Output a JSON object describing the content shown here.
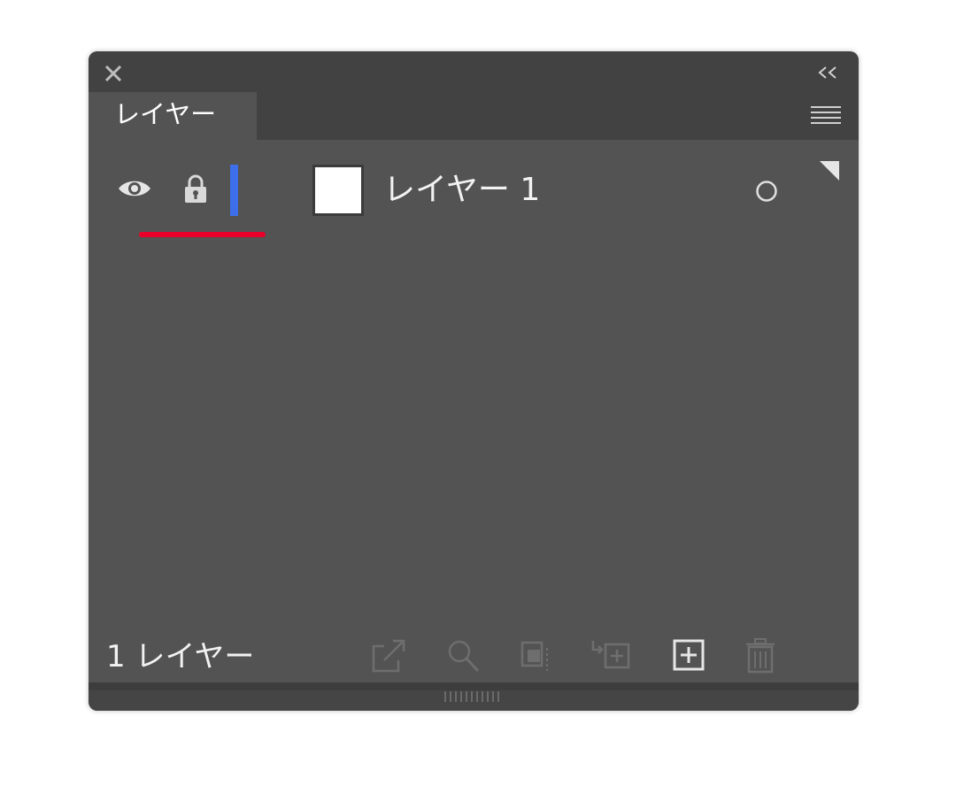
{
  "panel": {
    "tab_label": "レイヤー",
    "close_icon": "close-icon",
    "collapse_icon": "double-chevron-left-icon",
    "menu_icon": "hamburger-menu-icon"
  },
  "layers": [
    {
      "name": "レイヤー 1",
      "visible": true,
      "locked": true,
      "color": "#3d6fea",
      "thumbnail_color": "#ffffff"
    }
  ],
  "annotation": {
    "highlight_color": "#e8002b"
  },
  "footer": {
    "layer_count_label": "1 レイヤー",
    "buttons": [
      "export-icon",
      "locate-object-icon",
      "make-clipping-mask-icon",
      "create-sublayer-icon",
      "new-layer-icon",
      "delete-icon"
    ]
  },
  "colors": {
    "panel_bg": "#535353",
    "header_bg": "#424242",
    "text": "#f2f2f2"
  }
}
